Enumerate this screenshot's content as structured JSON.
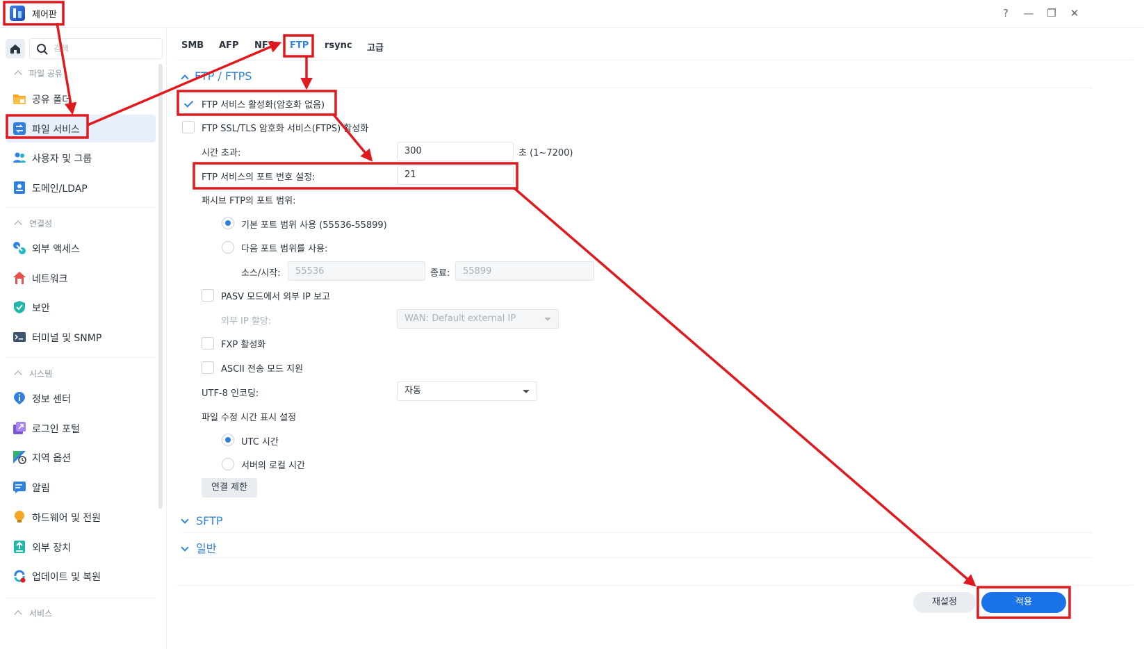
{
  "window": {
    "title": "제어판",
    "help": "?",
    "minimize": "—",
    "maximize": "❐",
    "close": "✕"
  },
  "sidebar": {
    "search_placeholder": "검색",
    "groups": [
      {
        "label": "파일 공유",
        "items": [
          "공유 폴더",
          "파일 서비스",
          "사용자 및 그룹",
          "도메인/LDAP"
        ]
      },
      {
        "label": "연결성",
        "items": [
          "외부 액세스",
          "네트워크",
          "보안",
          "터미널 및 SNMP"
        ]
      },
      {
        "label": "시스템",
        "items": [
          "정보 센터",
          "로그인 포털",
          "지역 옵션",
          "알림",
          "하드웨어 및 전원",
          "외부 장치",
          "업데이트 및 복원"
        ]
      },
      {
        "label": "서비스",
        "items": []
      }
    ],
    "active_item": "파일 서비스"
  },
  "tabs": [
    "SMB",
    "AFP",
    "NFS",
    "FTP",
    "rsync",
    "고급"
  ],
  "active_tab": "FTP",
  "ftp": {
    "section_title": "FTP / FTPS",
    "enable_ftp": {
      "label": "FTP 서비스 활성화(암호화 없음)",
      "checked": true
    },
    "enable_ftps": {
      "label": "FTP SSL/TLS 암호화 서비스(FTPS) 활성화",
      "checked": false
    },
    "timeout": {
      "label": "시간 초과:",
      "value": "300",
      "unit": "초 (1~7200)"
    },
    "port": {
      "label": "FTP 서비스의 포트 번호 설정:",
      "value": "21"
    },
    "passive_range_label": "패시브 FTP의 포트 범위:",
    "passive_default": {
      "label": "기본 포트 범위 사용 (55536-55899)",
      "selected": true
    },
    "passive_custom": {
      "label": "다음 포트 범위를 사용:",
      "selected": false
    },
    "source_start": {
      "label": "소스/시작:",
      "placeholder": "55536"
    },
    "end": {
      "label": "종료:",
      "placeholder": "55899"
    },
    "pasv_report": {
      "label": "PASV 모드에서 외부 IP 보고",
      "checked": false
    },
    "external_ip": {
      "label": "외부 IP 할당:",
      "value": "WAN: Default external IP"
    },
    "fxp": {
      "label": "FXP 활성화",
      "checked": false
    },
    "ascii": {
      "label": "ASCII 전송 모드 지원",
      "checked": false
    },
    "utf8": {
      "label": "UTF-8 인코딩:",
      "value": "자동"
    },
    "mtime_label": "파일 수정 시간 표시 설정",
    "mtime_utc": {
      "label": "UTC 시간",
      "selected": true
    },
    "mtime_local": {
      "label": "서버의 로컬 시간",
      "selected": false
    },
    "connection_limit": "연결 제한"
  },
  "sections": {
    "sftp": "SFTP",
    "general": "일반"
  },
  "footer": {
    "reset": "재설정",
    "apply": "적용"
  },
  "colors": {
    "accent": "#2f80e0",
    "apply_button": "#1a73e8",
    "annotation": "#e0191e"
  }
}
